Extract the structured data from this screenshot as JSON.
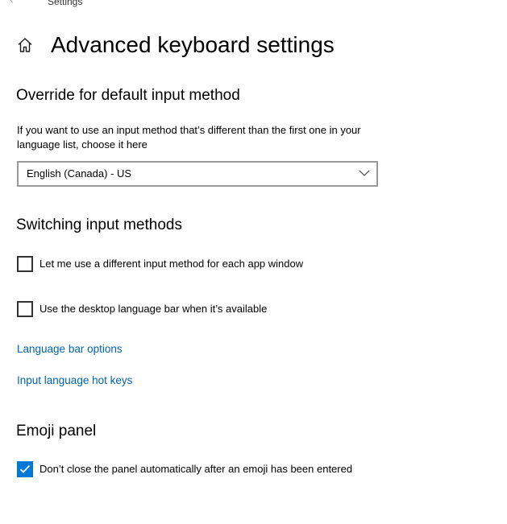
{
  "window": {
    "title": "Settings",
    "back_icon": "back-arrow-icon"
  },
  "header": {
    "home_icon": "home-icon",
    "title": "Advanced keyboard settings"
  },
  "override": {
    "heading": "Override for default input method",
    "description": "If you want to use an input method that’s different than the first one in your language list, choose it here",
    "selected_value": "English (Canada) - US"
  },
  "switching": {
    "heading": "Switching input methods",
    "per_app_label": "Let me use a different input method for each app window",
    "per_app_checked": false,
    "desktop_bar_label": "Use the desktop language bar when it’s available",
    "desktop_bar_checked": false,
    "language_bar_link": "Language bar options",
    "hot_keys_link": "Input language hot keys"
  },
  "emoji": {
    "heading": "Emoji panel",
    "keep_open_label": "Don’t close the panel automatically after an emoji has been entered",
    "keep_open_checked": true
  },
  "colors": {
    "accent": "#0078d7",
    "link": "#0063b1"
  }
}
